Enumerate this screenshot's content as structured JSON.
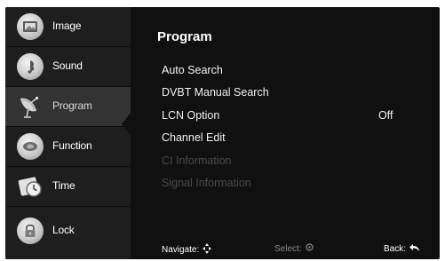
{
  "sidebar": {
    "items": [
      {
        "label": "Image",
        "icon": "image-icon"
      },
      {
        "label": "Sound",
        "icon": "music-note-icon"
      },
      {
        "label": "Program",
        "icon": "satellite-dish-icon",
        "active": true
      },
      {
        "label": "Function",
        "icon": "function-icon"
      },
      {
        "label": "Time",
        "icon": "clock-icon"
      },
      {
        "label": "Lock",
        "icon": "lock-icon"
      }
    ]
  },
  "main": {
    "title": "Program",
    "menu": [
      {
        "label": "Auto Search",
        "enabled": true
      },
      {
        "label": "DVBT Manual Search",
        "enabled": true
      },
      {
        "label": "LCN Option",
        "value": "Off",
        "enabled": true
      },
      {
        "label": "Channel Edit",
        "enabled": true
      },
      {
        "label": "CI Information",
        "enabled": false
      },
      {
        "label": "Signal Information",
        "enabled": false
      }
    ]
  },
  "footer": {
    "navigate": "Navigate:",
    "select": "Select:",
    "back": "Back:"
  },
  "colors": {
    "background": "#101010",
    "sidebar": "#1e1e1e",
    "active_item": "#333333",
    "text": "#ffffff",
    "disabled_text": "#4a4a4a"
  }
}
